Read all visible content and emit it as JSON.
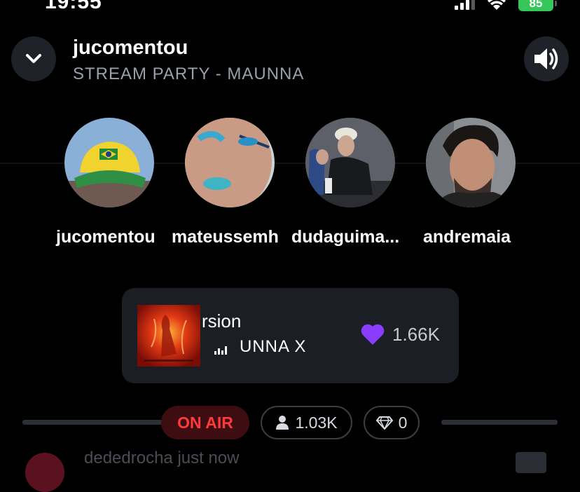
{
  "status_bar": {
    "time": "19:55",
    "battery": "85"
  },
  "header": {
    "title": "jucomentou",
    "subtitle": "STREAM PARTY - MAUNNA",
    "collapse_icon": "chevron-down-icon",
    "volume_icon": "speaker-volume-icon"
  },
  "participants": [
    {
      "name": "jucomentou"
    },
    {
      "name": "mateussemh"
    },
    {
      "name": "dudaguima..."
    },
    {
      "name": "andremaia"
    }
  ],
  "now_playing": {
    "title": "rsion",
    "artist": "UNNA X",
    "likes": "1.66K",
    "heart_color": "#8b3dff"
  },
  "stats": {
    "on_air": "ON AIR",
    "listeners": "1.03K",
    "gems": "0"
  },
  "peek": {
    "text": "dededrocha just now"
  },
  "colors": {
    "on_air_bg": "#3e0d12",
    "on_air_text": "#ff3a3a",
    "card_bg": "#1b1e25"
  }
}
